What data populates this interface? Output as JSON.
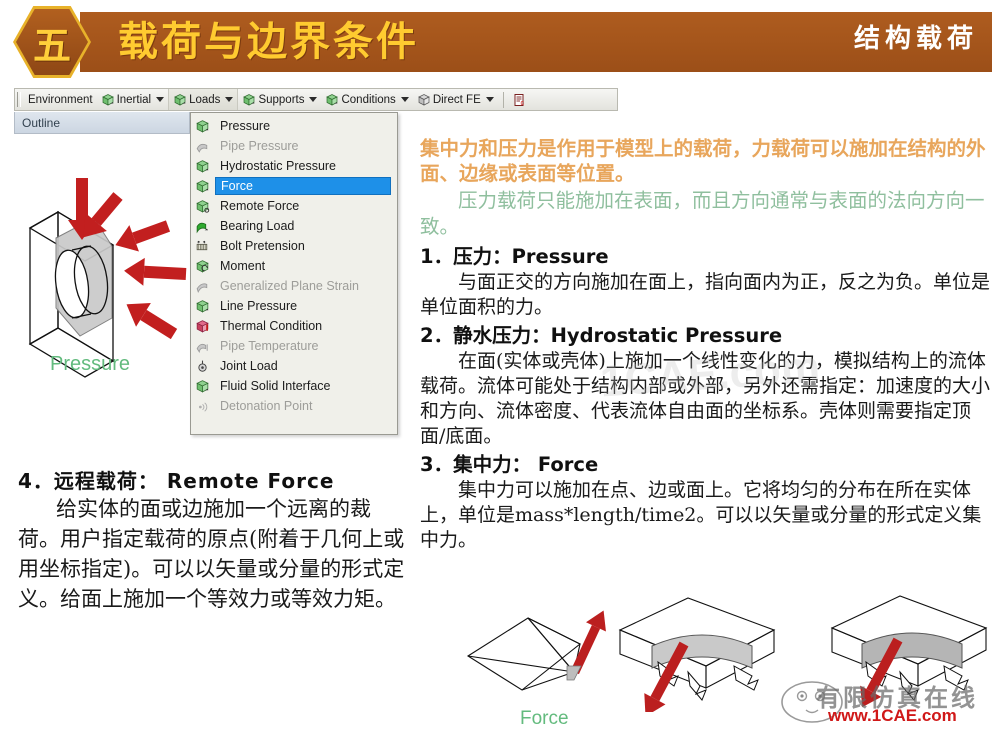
{
  "header": {
    "badge_number": "五",
    "title": "载荷与边界条件",
    "subtitle": "结构载荷",
    "bar_color": "#a5551c",
    "title_color": "#ffcb30",
    "badge_border_color": "#e8b22a"
  },
  "toolbar": {
    "buttons": [
      {
        "label": "Environment",
        "icon": "",
        "has_caret": false,
        "active": false
      },
      {
        "label": "Inertial",
        "icon": "green-cube-icon",
        "has_caret": true,
        "active": false
      },
      {
        "label": "Loads",
        "icon": "green-cube-icon",
        "has_caret": true,
        "active": true
      },
      {
        "label": "Supports",
        "icon": "green-cube-icon",
        "has_caret": true,
        "active": false
      },
      {
        "label": "Conditions",
        "icon": "green-cube-icon",
        "has_caret": true,
        "active": false
      },
      {
        "label": "Direct FE",
        "icon": "green-cube-icon",
        "has_caret": true,
        "active": false
      }
    ],
    "end_icon": "report-preview-icon"
  },
  "outline": {
    "title": "Outline"
  },
  "loads_menu": {
    "items": [
      {
        "label": "Pressure",
        "icon": "green-cube-icon",
        "state": "normal"
      },
      {
        "label": "Pipe Pressure",
        "icon": "pipe-icon",
        "state": "disabled"
      },
      {
        "label": "Hydrostatic Pressure",
        "icon": "green-cube-icon",
        "state": "normal"
      },
      {
        "label": "Force",
        "icon": "green-cube-icon",
        "state": "selected"
      },
      {
        "label": "Remote Force",
        "icon": "green-cube-icon",
        "state": "normal"
      },
      {
        "label": "Bearing Load",
        "icon": "bearing-icon",
        "state": "normal"
      },
      {
        "label": "Bolt Pretension",
        "icon": "bolt-icon",
        "state": "normal"
      },
      {
        "label": "Moment",
        "icon": "moment-icon",
        "state": "normal"
      },
      {
        "label": "Generalized Plane Strain",
        "icon": "plane-strain-icon",
        "state": "disabled"
      },
      {
        "label": "Line Pressure",
        "icon": "green-cube-icon",
        "state": "normal"
      },
      {
        "label": "Thermal Condition",
        "icon": "thermal-icon",
        "state": "normal"
      },
      {
        "label": "Pipe Temperature",
        "icon": "pipe-temp-icon",
        "state": "disabled"
      },
      {
        "label": "Joint Load",
        "icon": "joint-icon",
        "state": "normal"
      },
      {
        "label": "Fluid Solid Interface",
        "icon": "green-cube-icon",
        "state": "normal"
      },
      {
        "label": "Detonation Point",
        "icon": "detonation-icon",
        "state": "disabled"
      }
    ],
    "selected_highlight_color": "#1e90e8"
  },
  "figures": {
    "pressure_caption": "Pressure",
    "force_caption": "Force",
    "caption_color": "#63bb7e"
  },
  "right_column": {
    "intro_orange": "集中力和压力是作用于模型上的载荷，力载荷可以施加在结构的外面、边缘或表面等位置。",
    "intro_teal": "压力载荷只能施加在表面，而且方向通常与表面的法向方向一致。",
    "sections": [
      {
        "heading": "1．压力：Pressure",
        "body": "与面正交的方向施加在面上，指向面内为正，反之为负。单位是单位面积的力。"
      },
      {
        "heading": "2．静水压力：Hydrostatic Pressure",
        "body": "在面(实体或壳体)上施加一个线性变化的力，模拟结构上的流体载荷。流体可能处于结构内部或外部，另外还需指定：加速度的大小和方向、流体密度、代表流体自由面的坐标系。壳体则需要指定顶面/底面。"
      },
      {
        "heading": "3．集中力： Force",
        "body": "集中力可以施加在点、边或面上。它将均匀的分布在所在实体上，单位是mass*length/time2。可以以矢量或分量的形式定义集中力。"
      }
    ]
  },
  "left_bottom": {
    "heading": "4．远程载荷： Remote  Force",
    "body": "给实体的面或边施加一个远离的裁荷。用户指定载荷的原点(附着于几何上或用坐标指定)。可以以矢量或分量的形式定义。给面上施加一个等效力或等效力矩。"
  },
  "watermark": {
    "center_text": "1CAE.com",
    "brand_cn": "有限仿真在线",
    "brand_url": "www.1CAE.com",
    "url_color": "#d01818"
  }
}
